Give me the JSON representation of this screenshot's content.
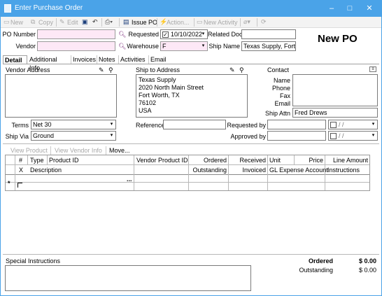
{
  "window": {
    "title": "Enter Purchase Order"
  },
  "toolbar": {
    "new": "New",
    "copy": "Copy",
    "edit": "Edit",
    "issue_po": "Issue PO",
    "action": "Action...",
    "new_activity": "New Activity"
  },
  "header": {
    "po_number_label": "PO Number",
    "po_number": "",
    "vendor_label": "Vendor",
    "vendor": "",
    "requested_label": "Requested",
    "requested_date": "10/10/2022",
    "warehouse_label": "Warehouse",
    "warehouse": "F",
    "related_doc_label": "Related Doc",
    "related_doc": "",
    "ship_name_label": "Ship Name",
    "ship_name": "Texas Supply, Fort W",
    "status_title": "New PO"
  },
  "tabs": [
    "Detail",
    "Additional Info",
    "Invoices",
    "Notes",
    "Activities",
    "Email"
  ],
  "vendor_address": {
    "label": "Vendor Address"
  },
  "ship_to": {
    "label": "Ship to Address",
    "lines": [
      "Texas Supply",
      "2020 North Main Street",
      "Fort Worth, TX",
      "76102",
      "USA"
    ]
  },
  "contact": {
    "label": "Contact",
    "name_label": "Name",
    "phone_label": "Phone",
    "fax_label": "Fax",
    "email_label": "Email",
    "ship_attn_label": "Ship Attn",
    "ship_attn": "Fred Drews"
  },
  "terms": {
    "label": "Terms",
    "value": "Net 30"
  },
  "ship_via": {
    "label": "Ship Via",
    "value": "Ground"
  },
  "reference": {
    "label": "Reference",
    "value": ""
  },
  "requested_by": {
    "label": "Requested by",
    "value": "",
    "date": "/ /"
  },
  "approved_by": {
    "label": "Approved by",
    "value": "",
    "date": "/ /"
  },
  "lines_toolbar": {
    "view_product": "View Product",
    "view_vendor_info": "View Vendor Info",
    "move": "Move..."
  },
  "grid": {
    "row1": [
      "#",
      "Type",
      "Product ID",
      "Vendor Product ID",
      "Ordered",
      "Received",
      "Unit",
      "Price",
      "Line Amount"
    ],
    "row2": [
      "X",
      "Description",
      "Outstanding",
      "Invoiced",
      "GL Expense Account",
      "Instructions"
    ],
    "new_row_marker": "*",
    "ellipsis": "..."
  },
  "special_instructions": {
    "label": "Special Instructions",
    "value": ""
  },
  "totals": {
    "ordered_label": "Ordered",
    "ordered": "$ 0.00",
    "outstanding_label": "Outstanding",
    "outstanding": "$ 0.00"
  }
}
